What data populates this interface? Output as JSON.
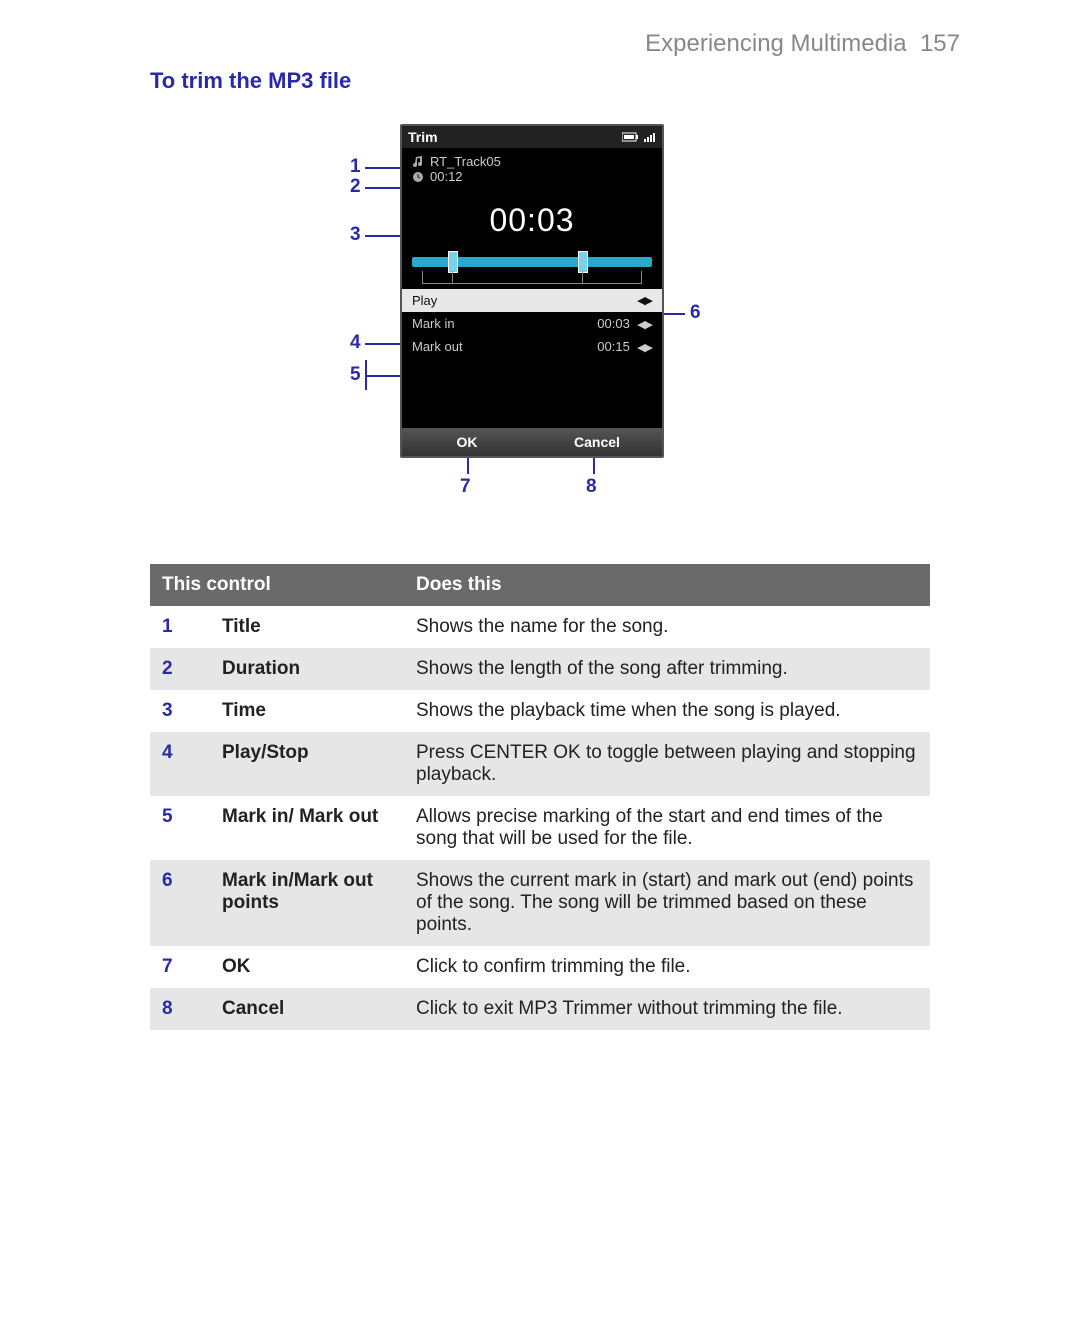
{
  "page": {
    "chapter": "Experiencing Multimedia",
    "number": "157",
    "section_title": "To trim the MP3 file"
  },
  "phone": {
    "screen_title": "Trim",
    "track_name": "RT_Track05",
    "duration": "00:12",
    "playback_time": "00:03",
    "rows": {
      "play": "Play",
      "mark_in_label": "Mark in",
      "mark_in_value": "00:03",
      "mark_out_label": "Mark out",
      "mark_out_value": "00:15"
    },
    "softkeys": {
      "ok": "OK",
      "cancel": "Cancel"
    }
  },
  "callouts": [
    "1",
    "2",
    "3",
    "4",
    "5",
    "6",
    "7",
    "8"
  ],
  "table": {
    "head_control": "This control",
    "head_does": "Does this",
    "rows": [
      {
        "n": "1",
        "name": "Title",
        "desc": "Shows the name for the song."
      },
      {
        "n": "2",
        "name": "Duration",
        "desc": "Shows the length of the song after trimming."
      },
      {
        "n": "3",
        "name": "Time",
        "desc": "Shows the playback time when the song is played."
      },
      {
        "n": "4",
        "name": "Play/Stop",
        "desc": "Press CENTER OK to toggle between playing and stopping playback."
      },
      {
        "n": "5",
        "name": "Mark in/ Mark out",
        "desc": "Allows precise marking of the start and end times of the song that will be used for the file."
      },
      {
        "n": "6",
        "name": "Mark in/Mark out points",
        "desc": "Shows the current mark in (start) and mark out (end) points of the song. The song will be trimmed based on these points."
      },
      {
        "n": "7",
        "name": "OK",
        "desc": "Click to confirm trimming the file."
      },
      {
        "n": "8",
        "name": "Cancel",
        "desc": "Click to exit MP3 Trimmer without trimming the file."
      }
    ]
  }
}
